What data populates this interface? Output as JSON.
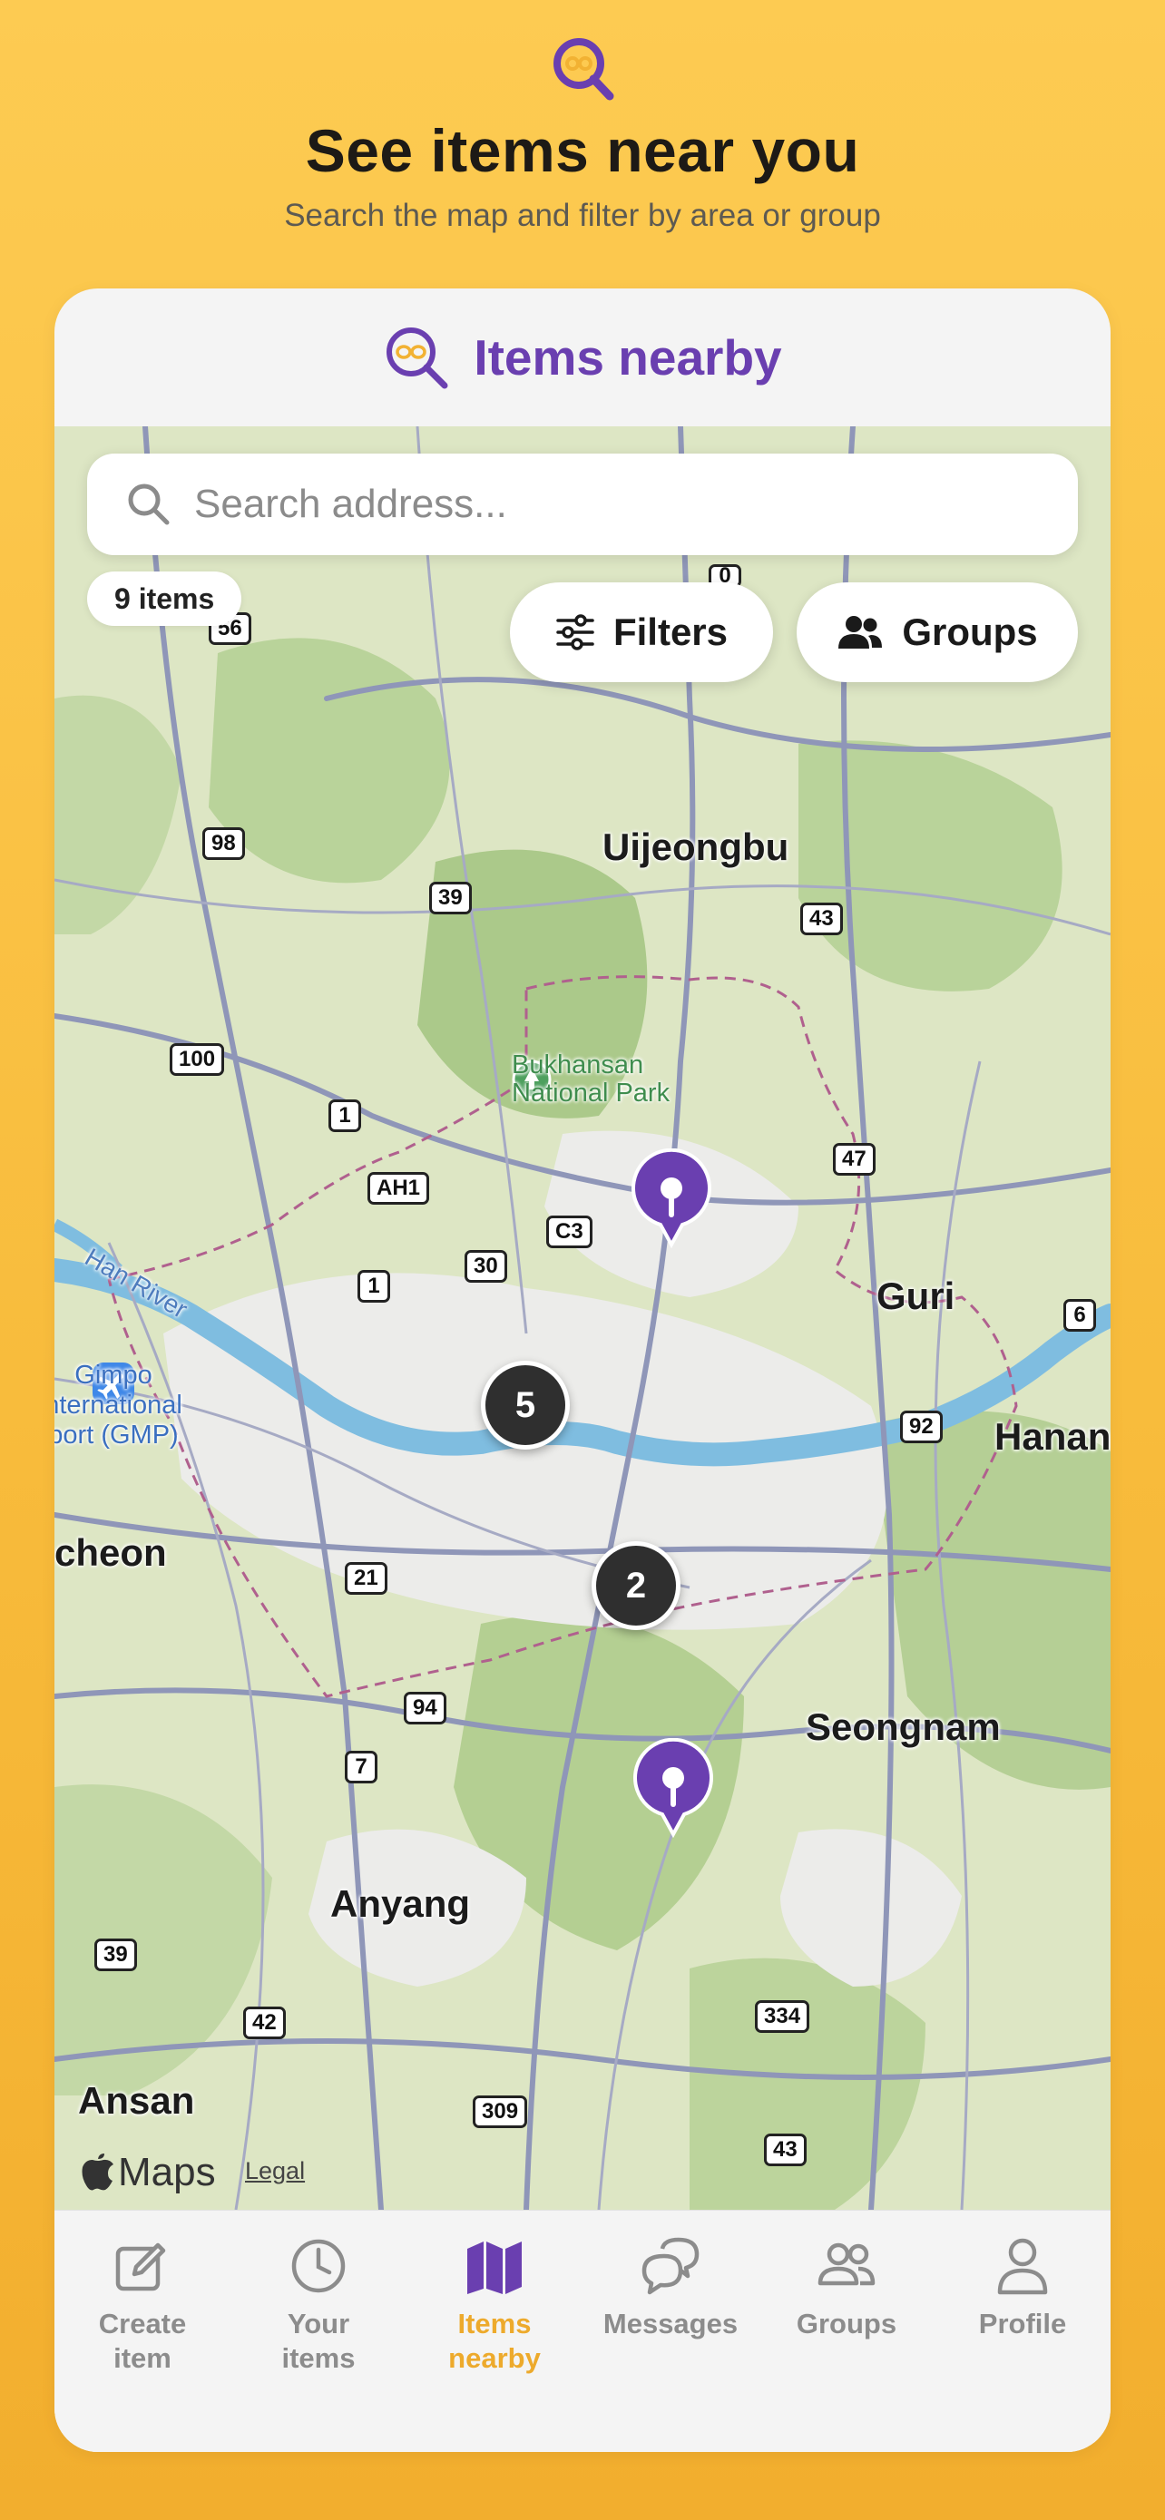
{
  "hero": {
    "headline": "See items near you",
    "subline": "Search the map and filter by area or group",
    "logo_icon": "magnifier-glasses-logo-icon"
  },
  "card": {
    "title": "Items nearby"
  },
  "map": {
    "search_placeholder": "Search address...",
    "item_count": "9 items",
    "filters_label": "Filters",
    "groups_label": "Groups",
    "cities": {
      "uijeongbu": "Uijeongbu",
      "guri": "Guri",
      "hanam": "Hanan",
      "seongnam": "Seongnam",
      "anyang": "Anyang",
      "ansan": "Ansan",
      "incheon": "cheon"
    },
    "park": {
      "line1": "Bukhansan",
      "line2": "National Park"
    },
    "airport": {
      "line1": "Gimpo",
      "line2": "nternational",
      "line3": "port (GMP)"
    },
    "river": "Han River",
    "roads": [
      "56",
      "98",
      "39",
      "43",
      "100",
      "1",
      "AH1",
      "47",
      "C3",
      "30",
      "1",
      "6",
      "92",
      "21",
      "94",
      "7",
      "39",
      "42",
      "334",
      "309",
      "43",
      "0"
    ],
    "clusters": [
      "5",
      "2"
    ],
    "attribution": "Maps",
    "legal": "Legal"
  },
  "tabs": [
    {
      "label": "Create item",
      "icon": "create-icon",
      "active": false
    },
    {
      "label": "Your items",
      "icon": "clock-icon",
      "active": false
    },
    {
      "label": "Items nearby",
      "icon": "map-icon",
      "active": true
    },
    {
      "label": "Messages",
      "icon": "chat-bubbles-icon",
      "active": false
    },
    {
      "label": "Groups",
      "icon": "people-icon",
      "active": false
    },
    {
      "label": "Profile",
      "icon": "person-icon",
      "active": false
    }
  ],
  "colors": {
    "brand_purple": "#6a3fb0",
    "brand_yellow": "#EDAA2C",
    "background": "#FDCB52"
  }
}
